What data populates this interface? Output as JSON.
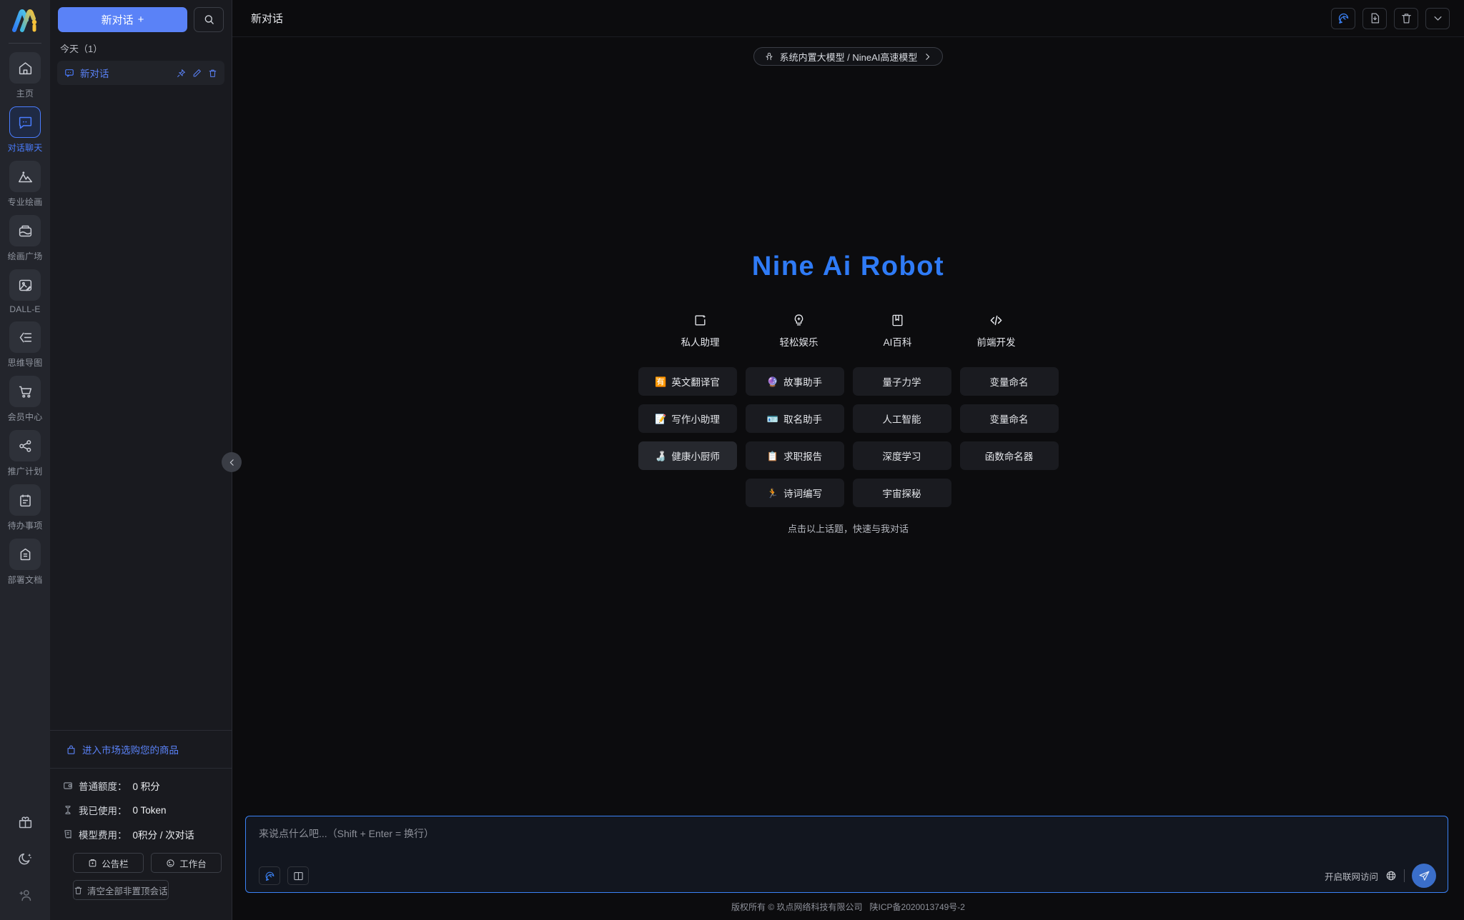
{
  "rail": {
    "logo": "Ai-logo",
    "items": [
      {
        "label": "主页",
        "icon": "home-icon",
        "active": false
      },
      {
        "label": "对话聊天",
        "icon": "chat-icon",
        "active": true
      },
      {
        "label": "专业绘画",
        "icon": "image-mountain-icon",
        "active": false
      },
      {
        "label": "绘画广场",
        "icon": "gallery-icon",
        "active": false
      },
      {
        "label": "DALL-E",
        "icon": "picture-pen-icon",
        "active": false
      },
      {
        "label": "思维导图",
        "icon": "mindmap-icon",
        "active": false
      },
      {
        "label": "会员中心",
        "icon": "cart-icon",
        "active": false
      },
      {
        "label": "推广计划",
        "icon": "share-icon",
        "active": false
      },
      {
        "label": "待办事项",
        "icon": "clipboard-icon",
        "active": false
      },
      {
        "label": "部署文档",
        "icon": "doc-archive-icon",
        "active": false
      }
    ],
    "bottom": [
      {
        "icon": "gift-icon"
      },
      {
        "icon": "moon-icon"
      },
      {
        "icon": "add-user-icon"
      }
    ]
  },
  "convo": {
    "new_chat_label": "新对话",
    "new_chat_plus": "+",
    "search_icon": "search-icon",
    "group_label": "今天（1）",
    "items": [
      {
        "title": "新对话",
        "icon": "chat-bubble-icon"
      }
    ],
    "item_actions": [
      "pin-icon",
      "edit-icon",
      "delete-icon"
    ],
    "market_link": "进入市场选购您的商品",
    "market_icon": "shop-icon",
    "stats": [
      {
        "icon": "credit-icon",
        "key": "普通额度：",
        "value": "0 积分"
      },
      {
        "icon": "hourglass-icon",
        "key": "我已使用：",
        "value": "0 Token"
      },
      {
        "icon": "receipt-icon",
        "key": "模型费用：",
        "value": "0积分 / 次对话"
      }
    ],
    "buttons": [
      {
        "label": "公告栏",
        "icon": "megaphone-icon"
      },
      {
        "label": "工作台",
        "icon": "workbench-icon"
      }
    ],
    "clear_button": {
      "label": "清空全部非置顶会话",
      "icon": "trash-icon"
    },
    "collapse_icon": "chevron-left-icon"
  },
  "header": {
    "title": "新对话",
    "buttons": [
      {
        "name": "history-button",
        "icon": "clock-chat-icon",
        "accent": true
      },
      {
        "name": "save-button",
        "icon": "file-download-icon",
        "accent": false
      },
      {
        "name": "delete-button",
        "icon": "trash-icon",
        "accent": false
      },
      {
        "name": "more-button",
        "icon": "chevron-down-icon",
        "accent": false
      }
    ]
  },
  "model": {
    "icon": "model-icon",
    "label": "系统内置大模型 / NineAI高速模型",
    "chevron": "chevron-right-icon"
  },
  "welcome": {
    "brand": "Nine Ai Robot",
    "categories": [
      {
        "label": "私人助理",
        "icon": "assistant-icon"
      },
      {
        "label": "轻松娱乐",
        "icon": "bulb-icon"
      },
      {
        "label": "AI百科",
        "icon": "book-icon"
      },
      {
        "label": "前端开发",
        "icon": "code-icon"
      }
    ],
    "chip_rows": [
      [
        {
          "label": "英文翻译官",
          "emoji": "🈶",
          "lift": false,
          "spacer": false
        },
        {
          "label": "故事助手",
          "emoji": "🔮",
          "lift": false,
          "spacer": false
        },
        {
          "label": "量子力学",
          "emoji": "",
          "lift": false,
          "spacer": false
        },
        {
          "label": "变量命名",
          "emoji": "",
          "lift": false,
          "spacer": false
        }
      ],
      [
        {
          "label": "写作小助理",
          "emoji": "📝",
          "lift": false,
          "spacer": false
        },
        {
          "label": "取名助手",
          "emoji": "🪪",
          "lift": false,
          "spacer": false
        },
        {
          "label": "人工智能",
          "emoji": "",
          "lift": false,
          "spacer": false
        },
        {
          "label": "变量命名",
          "emoji": "",
          "lift": false,
          "spacer": false
        }
      ],
      [
        {
          "label": "健康小厨师",
          "emoji": "🍶",
          "lift": true,
          "spacer": false
        },
        {
          "label": "求职报告",
          "emoji": "📋",
          "lift": false,
          "spacer": false
        },
        {
          "label": "深度学习",
          "emoji": "",
          "lift": false,
          "spacer": false
        },
        {
          "label": "函数命名器",
          "emoji": "",
          "lift": false,
          "spacer": false
        }
      ],
      [
        {
          "label": "",
          "emoji": "",
          "lift": false,
          "spacer": true
        },
        {
          "label": "诗词编写",
          "emoji": "🏃",
          "lift": false,
          "spacer": false
        },
        {
          "label": "宇宙探秘",
          "emoji": "",
          "lift": false,
          "spacer": false
        },
        {
          "label": "",
          "emoji": "",
          "lift": false,
          "spacer": true
        }
      ]
    ],
    "hint": "点击以上话题，快速与我对话"
  },
  "composer": {
    "placeholder": "来说点什么吧...（Shift + Enter = 换行）",
    "value": "",
    "left_buttons": [
      {
        "name": "history-button",
        "icon": "clock-chat-icon",
        "accent": true
      },
      {
        "name": "prompt-library-button",
        "icon": "book-open-icon",
        "accent": false
      }
    ],
    "net_label": "开启联网访问",
    "net_icon": "globe-icon",
    "send_icon": "send-icon"
  },
  "footer": {
    "copyright": "版权所有 © 玖点网络科技有限公司",
    "icp": "陕ICP备2020013749号-2"
  }
}
